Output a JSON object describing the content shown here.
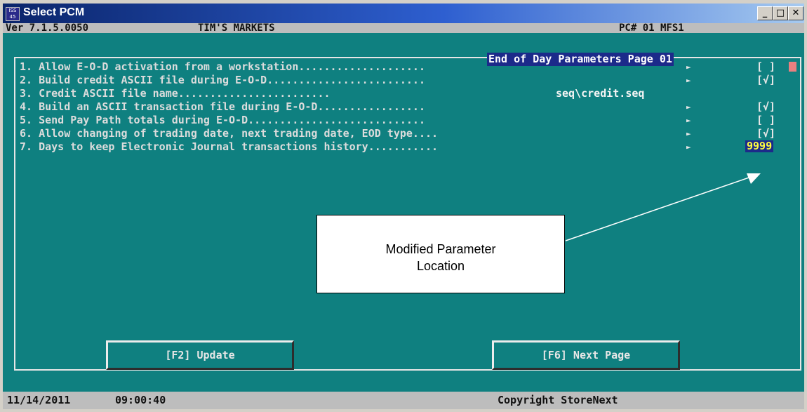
{
  "window": {
    "title": "Select PCM",
    "icon_text": "ISS 45",
    "controls": {
      "minimize": "_",
      "maximize": "□",
      "close": "✕"
    }
  },
  "header": {
    "version": "Ver 7.1.5.0050",
    "store": "TIM'S MARKETS",
    "pc": "PC# 01 MFS1"
  },
  "page_title": "End of Day Parameters Page 01",
  "parameters": [
    {
      "label": "1. Allow E-O-D activation from a workstation....................",
      "arrow": "►",
      "value": "[ ]"
    },
    {
      "label": "2. Build credit ASCII file during E-O-D.........................",
      "arrow": "►",
      "value": "[√]"
    },
    {
      "label": "3. Credit ASCII file name........................",
      "arrow": "",
      "value": "seq\\credit.seq"
    },
    {
      "label": "4. Build an ASCII transaction file during E-O-D.................",
      "arrow": "►",
      "value": "[√]"
    },
    {
      "label": "5. Send Pay Path totals during E-O-D............................",
      "arrow": "►",
      "value": "[ ]"
    },
    {
      "label": "6. Allow changing of trading date, next trading date, EOD type....",
      "arrow": "►",
      "value": "[√]"
    },
    {
      "label": "7. Days to keep Electronic Journal transactions history...........",
      "arrow": "►",
      "value": "9999"
    }
  ],
  "callout": {
    "line1": "Modified Parameter",
    "line2": "Location"
  },
  "buttons": {
    "update": "[F2] Update",
    "next_page": "[F6] Next Page"
  },
  "status": {
    "date": "11/14/2011",
    "time": "09:00:40",
    "copyright": "Copyright StoreNext"
  },
  "colors": {
    "console_background": "#0f8080",
    "title_highlight": "#1c2a8a",
    "edited_value": "#ffff40",
    "cursor": "#ea8080"
  }
}
